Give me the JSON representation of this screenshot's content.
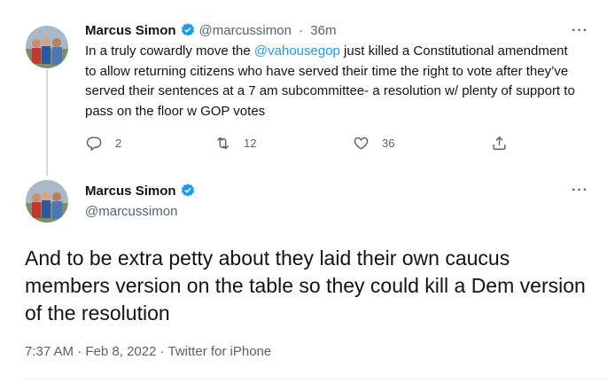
{
  "tweet1": {
    "author_name": "Marcus Simon",
    "author_handle": "@marcussimon",
    "separator": " · ",
    "time_ago": "36m",
    "text_prefix": "In a truly cowardly move the ",
    "mention": "@vahousegop",
    "text_suffix": " just killed a Constitutional amendment to allow returning citizens who have served their time the right to vote after they’ve served their sentences at a 7 am subcommittee- a resolution w/ plenty of support to pass on the floor w GOP votes",
    "more": "···",
    "actions": {
      "reply_count": "2",
      "retweet_count": "12",
      "like_count": "36"
    }
  },
  "tweet2": {
    "author_name": "Marcus Simon",
    "author_handle": "@marcussimon",
    "more": "···",
    "text": "And to be extra petty about they laid their own caucus members version on the table so they could kill a Dem version of the resolution",
    "time": "7:37 AM",
    "dot": " · ",
    "date": "Feb 8, 2022",
    "source": "Twitter for iPhone"
  },
  "colors": {
    "link": "#1d9bf0",
    "secondary": "#536471",
    "verified": "#1d9bf0",
    "text": "#0f1419"
  },
  "icons": [
    "verified-badge-icon",
    "reply-icon",
    "retweet-icon",
    "like-icon",
    "share-icon",
    "more-icon"
  ]
}
